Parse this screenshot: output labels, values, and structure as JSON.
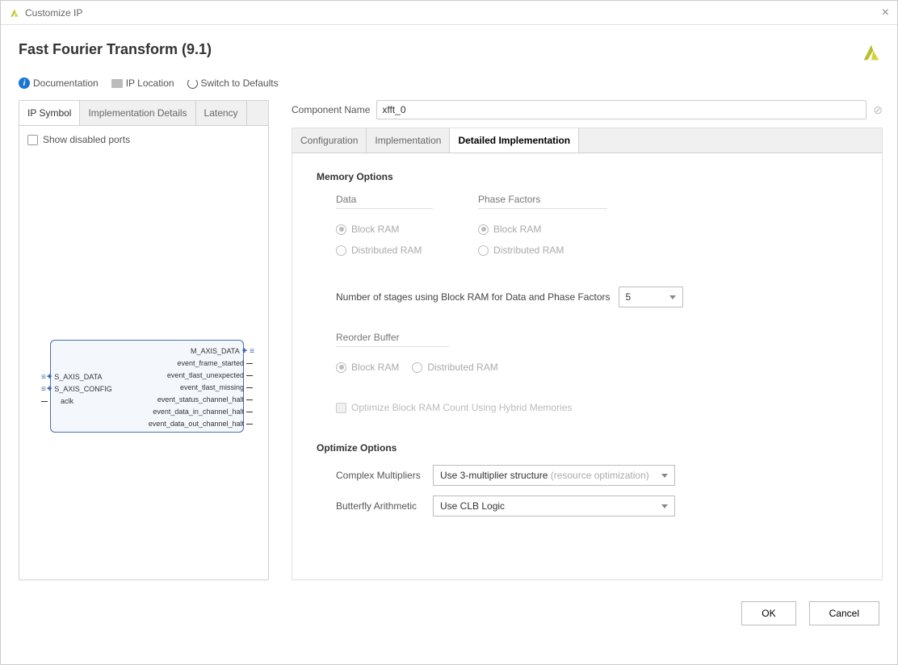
{
  "window": {
    "title": "Customize IP"
  },
  "page_title": "Fast Fourier Transform (9.1)",
  "toolbar": {
    "documentation": "Documentation",
    "ip_location": "IP Location",
    "switch_defaults": "Switch to Defaults"
  },
  "left": {
    "tabs": [
      "IP Symbol",
      "Implementation Details",
      "Latency"
    ],
    "active_tab": 0,
    "show_disabled_label": "Show disabled ports",
    "ports_left": [
      {
        "name": "S_AXIS_DATA",
        "expandable": true
      },
      {
        "name": "S_AXIS_CONFIG",
        "expandable": true
      },
      {
        "name": "aclk",
        "expandable": false
      }
    ],
    "ports_right": [
      {
        "name": "M_AXIS_DATA",
        "expandable": true
      },
      {
        "name": "event_frame_started",
        "expandable": false
      },
      {
        "name": "event_tlast_unexpected",
        "expandable": false
      },
      {
        "name": "event_tlast_missing",
        "expandable": false
      },
      {
        "name": "event_status_channel_halt",
        "expandable": false
      },
      {
        "name": "event_data_in_channel_halt",
        "expandable": false
      },
      {
        "name": "event_data_out_channel_halt",
        "expandable": false
      }
    ]
  },
  "component_name": {
    "label": "Component Name",
    "value": "xfft_0"
  },
  "config": {
    "tabs": [
      "Configuration",
      "Implementation",
      "Detailed Implementation"
    ],
    "active_tab": 2,
    "memory_section": "Memory Options",
    "data_label": "Data",
    "phase_label": "Phase Factors",
    "radio_block": "Block RAM",
    "radio_dist": "Distributed RAM",
    "stages_label": "Number of stages using Block RAM for Data and Phase Factors",
    "stages_value": "5",
    "reorder_label": "Reorder Buffer",
    "hybrid_label": "Optimize Block RAM Count Using Hybrid Memories",
    "optimize_section": "Optimize Options",
    "complex_label": "Complex Multipliers",
    "complex_value": "Use 3-multiplier structure",
    "complex_hint": "(resource optimization)",
    "butterfly_label": "Butterfly Arithmetic",
    "butterfly_value": "Use CLB Logic"
  },
  "footer": {
    "ok": "OK",
    "cancel": "Cancel"
  }
}
